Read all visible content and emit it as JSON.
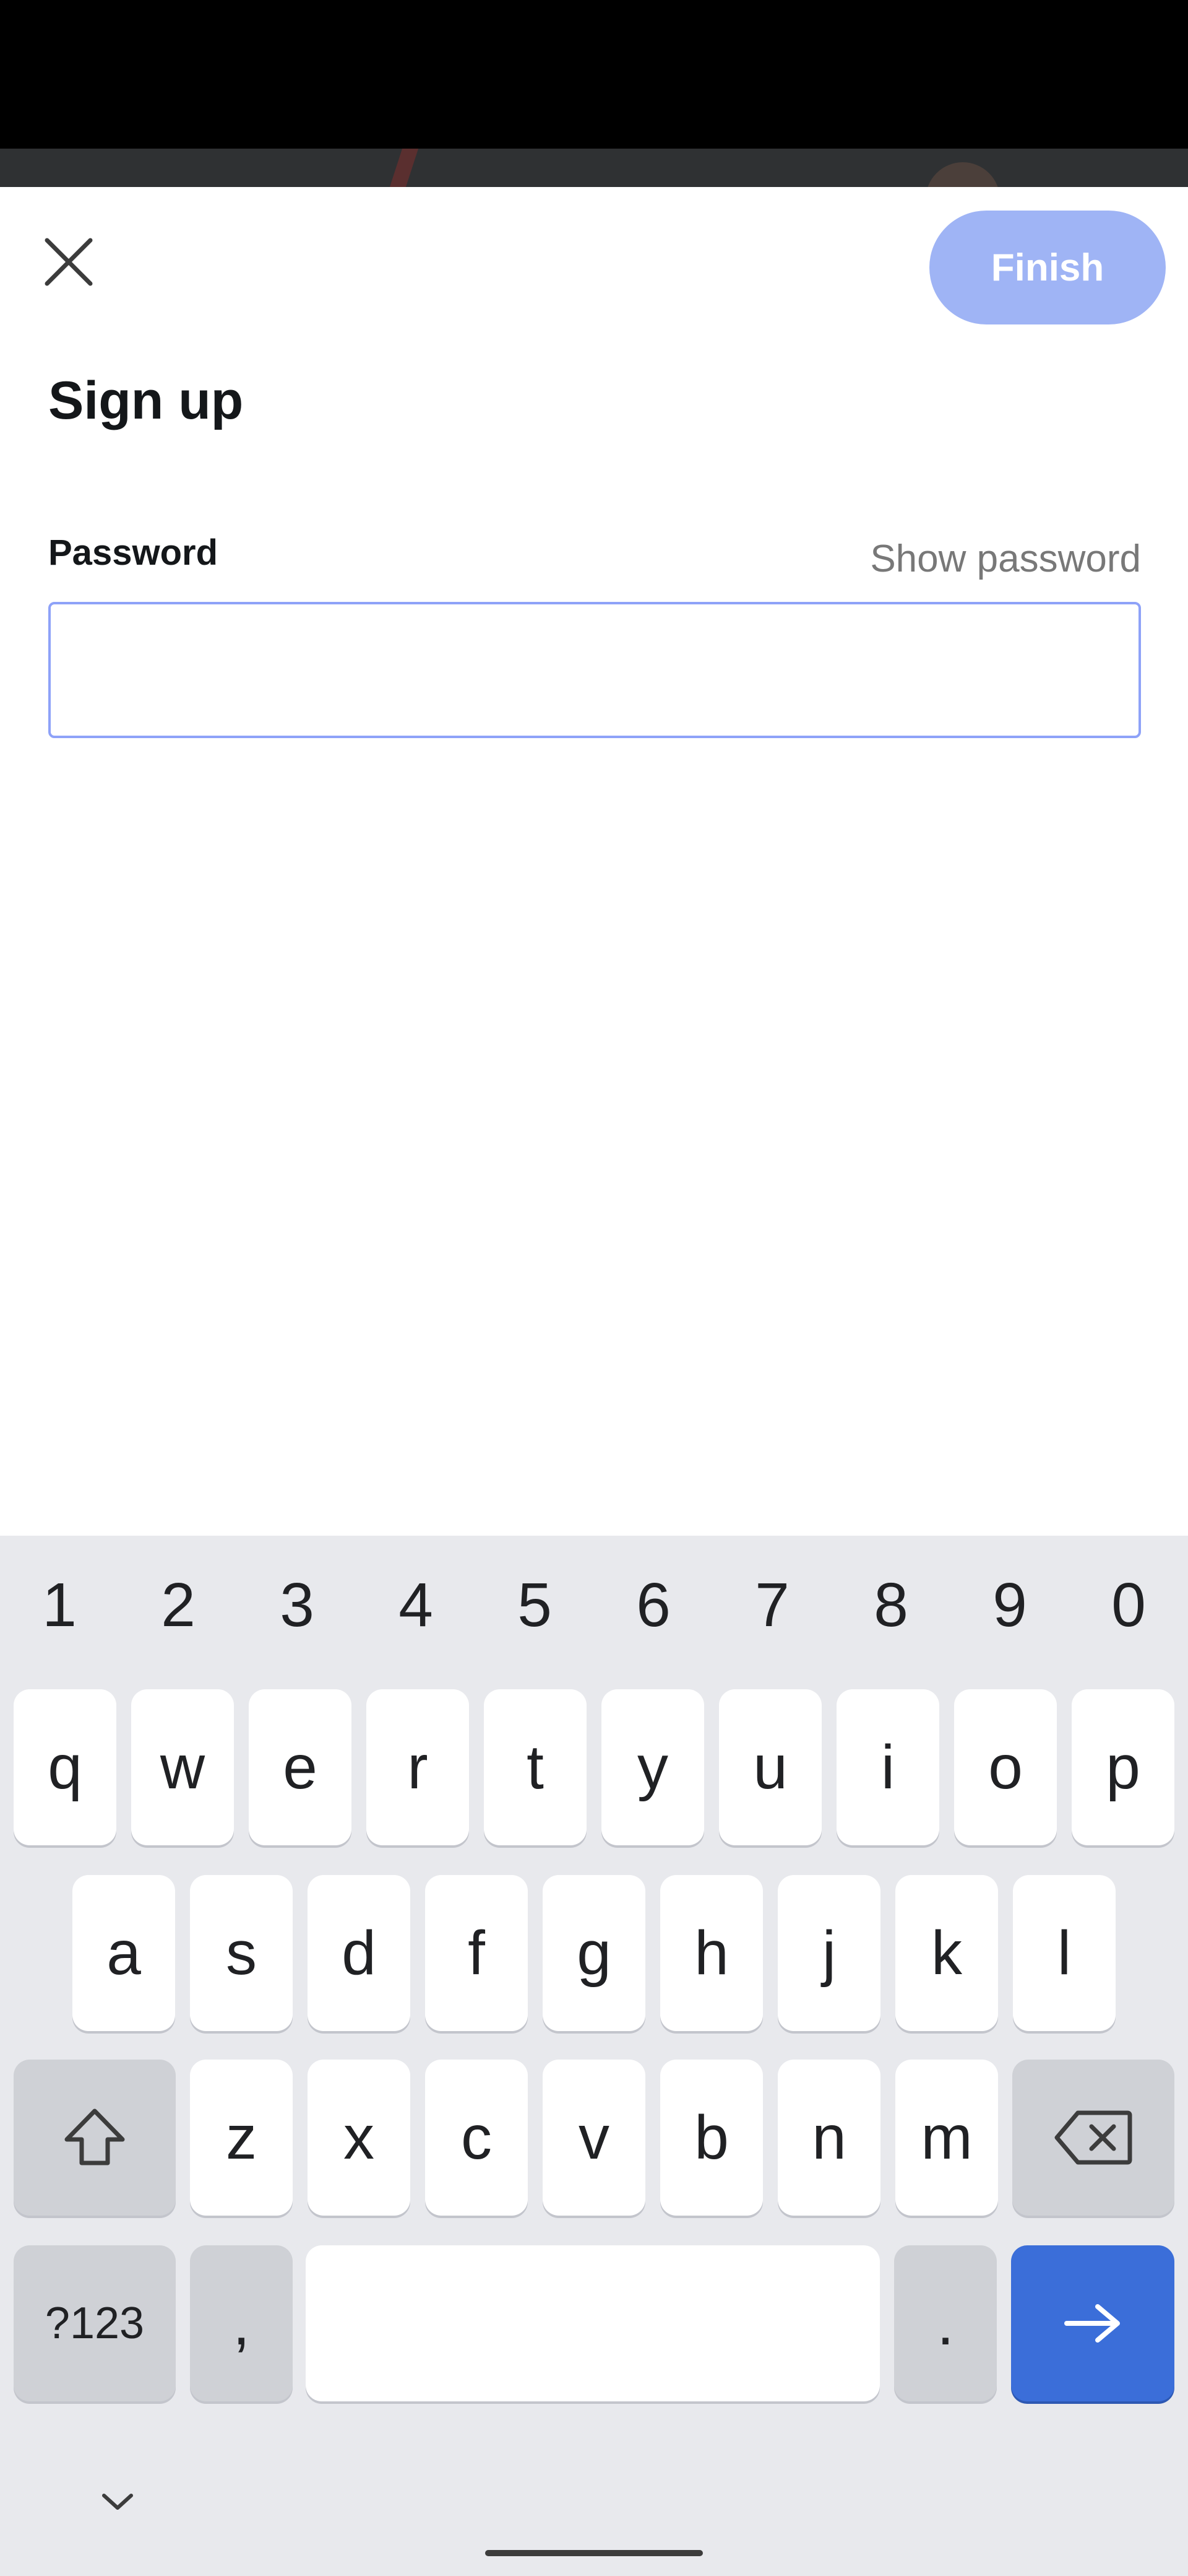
{
  "header": {
    "close_icon": "close-icon",
    "finish_label": "Finish"
  },
  "colors": {
    "finish_button": "#9fb4f5",
    "input_border": "#8ea2f8",
    "keyboard_bg": "#e8e9ed",
    "enter_key": "#3b6ed9"
  },
  "form": {
    "title": "Sign up",
    "password_label": "Password",
    "show_password_label": "Show password",
    "password_value": "",
    "password_placeholder": ""
  },
  "keyboard": {
    "number_row": [
      "1",
      "2",
      "3",
      "4",
      "5",
      "6",
      "7",
      "8",
      "9",
      "0"
    ],
    "row1": [
      "q",
      "w",
      "e",
      "r",
      "t",
      "y",
      "u",
      "i",
      "o",
      "p"
    ],
    "row2": [
      "a",
      "s",
      "d",
      "f",
      "g",
      "h",
      "j",
      "k",
      "l"
    ],
    "row3": [
      "z",
      "x",
      "c",
      "v",
      "b",
      "n",
      "m"
    ],
    "shift_icon": "shift-icon",
    "backspace_icon": "backspace-icon",
    "symbols_label": "?123",
    "comma_label": ",",
    "period_label": ".",
    "enter_icon": "arrow-right-icon",
    "collapse_icon": "chevron-down-icon"
  }
}
